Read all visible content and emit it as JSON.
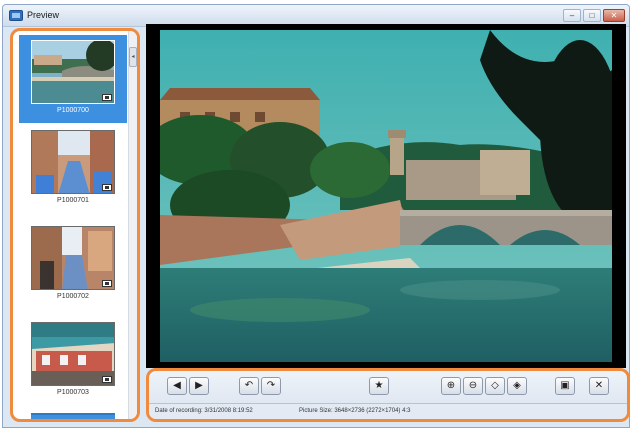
{
  "window": {
    "title": "Preview",
    "controls": {
      "minimize": "–",
      "maximize": "□",
      "close": "✕"
    }
  },
  "thumbnails": [
    {
      "label": "P1000700",
      "selected": true
    },
    {
      "label": "P1000701",
      "selected": false
    },
    {
      "label": "P1000702",
      "selected": false
    },
    {
      "label": "P1000703",
      "selected": false
    }
  ],
  "thumbnail_scroll": {
    "glyph": "◂"
  },
  "toolbar": {
    "buttons": {
      "previous": "◀",
      "next": "▶",
      "rotate_left": "↶",
      "rotate_right": "↷",
      "favorite": "★",
      "zoom_in": "⊕",
      "zoom_out": "⊖",
      "fit_in": "◇",
      "fit_out": "◈",
      "actual_size": "▣",
      "close": "✕"
    }
  },
  "status": {
    "recording_date": "Date of recording: 3/31/2008 8:19:52",
    "picture_size": "Picture Size: 3648×2736 (2272×1704) 4:3"
  },
  "colors": {
    "accent_outline": "#f08a3c",
    "selection": "#3d8fe0"
  }
}
